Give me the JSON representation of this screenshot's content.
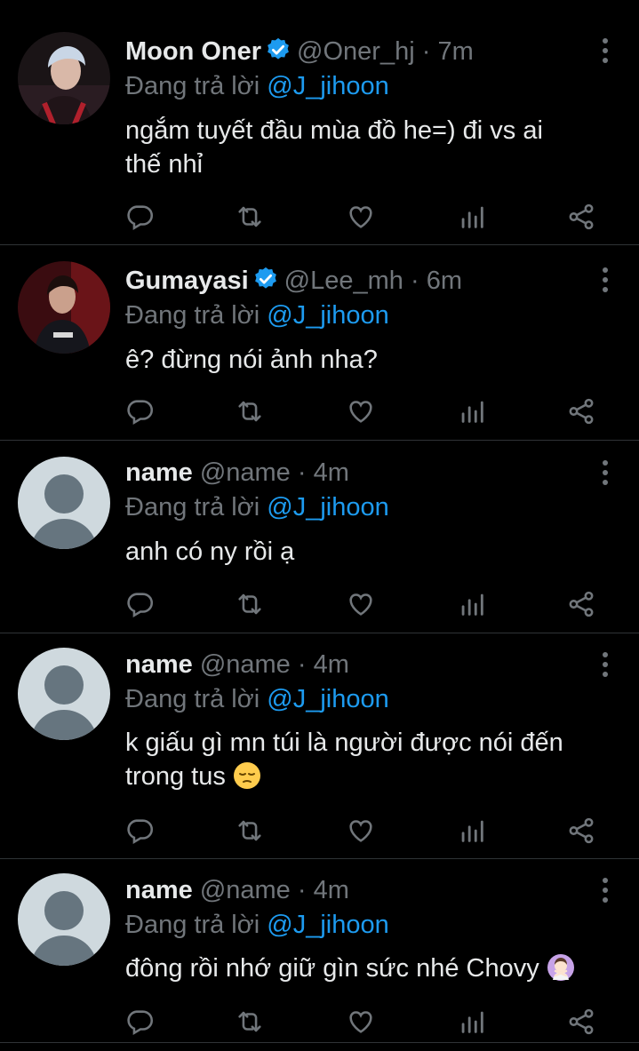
{
  "reply_prefix": "Đang trả lời",
  "tweets": [
    {
      "name": "Moon Oner",
      "verified": true,
      "handle": "@Oner_hj",
      "sep": "·",
      "time": "7m",
      "reply_to": "@J_jihoon",
      "text_line1": "ngắm tuyết đầu mùa đồ he=) đi vs ai",
      "text_line2": "thế nhỉ",
      "avatar": "photo"
    },
    {
      "name": "Gumayasi",
      "verified": true,
      "handle": "@Lee_mh",
      "sep": "·",
      "time": "6m",
      "reply_to": "@J_jihoon",
      "text_line1": "ê? đừng nói ảnh nha?",
      "avatar": "photo"
    },
    {
      "name": "name",
      "verified": false,
      "handle": "@name",
      "sep": "·",
      "time": "4m",
      "reply_to": "@J_jihoon",
      "text_line1": "anh có ny rồi ạ",
      "avatar": "default"
    },
    {
      "name": "name",
      "verified": false,
      "handle": "@name",
      "sep": "·",
      "time": "4m",
      "reply_to": "@J_jihoon",
      "text_line1": "k giấu gì mn túi là người được nói đến",
      "text_line2": "trong tus",
      "emoji": "pensive-face",
      "avatar": "default"
    },
    {
      "name": "name",
      "verified": false,
      "handle": "@name",
      "sep": "·",
      "time": "4m",
      "reply_to": "@J_jihoon",
      "text_line1": "đông rồi nhớ giữ gìn sức nhé Chovy",
      "emoji": "woman-gesturing-no",
      "avatar": "default"
    }
  ],
  "action_icons": [
    "reply-icon",
    "retweet-icon",
    "like-icon",
    "analytics-icon",
    "share-icon"
  ],
  "colors": {
    "background": "#000000",
    "text": "#e7e9ea",
    "muted": "#71767b",
    "accent": "#1d9bf0",
    "divider": "#2f3336"
  }
}
